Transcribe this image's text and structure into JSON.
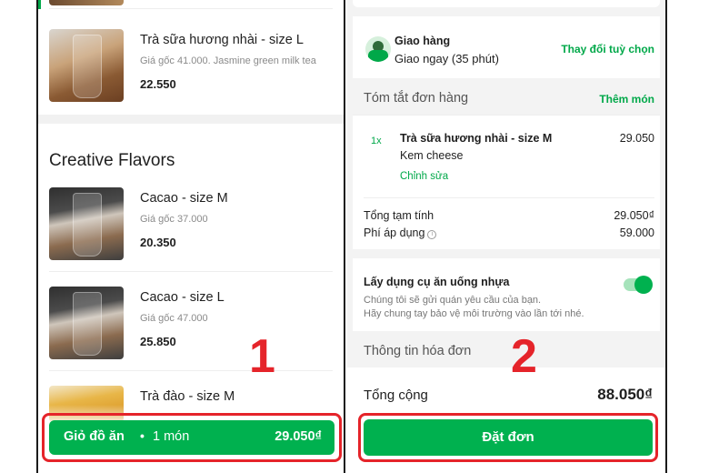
{
  "left": {
    "items_top": [
      {
        "name": "Trà sữa hương nhài - size L",
        "desc": "Giá gốc 41.000. Jasmine green milk tea",
        "price": "22.550"
      }
    ],
    "section_title": "Creative Flavors",
    "items": [
      {
        "name": "Cacao - size M",
        "desc": "Giá gốc 37.000",
        "price": "20.350"
      },
      {
        "name": "Cacao - size L",
        "desc": "Giá gốc 47.000",
        "price": "25.850"
      },
      {
        "name": "Trà đào - size M",
        "desc": "",
        "price": ""
      }
    ],
    "cart": {
      "label": "Giỏ đồ ăn",
      "separator": "•",
      "count": "1 món",
      "total": "29.050₫"
    }
  },
  "right": {
    "delivery": {
      "title": "Giao hàng",
      "subtitle": "Giao ngay (35 phút)",
      "change_link": "Thay đổi tuỳ chọn"
    },
    "summary": {
      "title": "Tóm tắt đơn hàng",
      "add_link": "Thêm món",
      "line": {
        "qty": "1x",
        "name": "Trà sữa hương nhài - size M",
        "option": "Kem cheese",
        "edit": "Chỉnh sửa",
        "price": "29.050"
      },
      "subtotal_label": "Tổng tạm tính",
      "subtotal_value": "29.050₫",
      "fee_label": "Phí áp dụng",
      "fee_value": "59.000"
    },
    "cutlery": {
      "title": "Lấy dụng cụ ăn uống nhựa",
      "desc1": "Chúng tôi sẽ gửi quán yêu cầu của bạn.",
      "desc2": "Hãy chung tay bảo vệ môi trường vào lần tới nhé.",
      "enabled": true
    },
    "invoice_title": "Thông tin hóa đơn",
    "total_label": "Tổng cộng",
    "total_value": "88.050₫",
    "order_button": "Đặt đơn"
  },
  "annotations": {
    "step1": "1",
    "step2": "2"
  },
  "colors": {
    "accent": "#00b14f",
    "annotation": "#e5242a"
  }
}
